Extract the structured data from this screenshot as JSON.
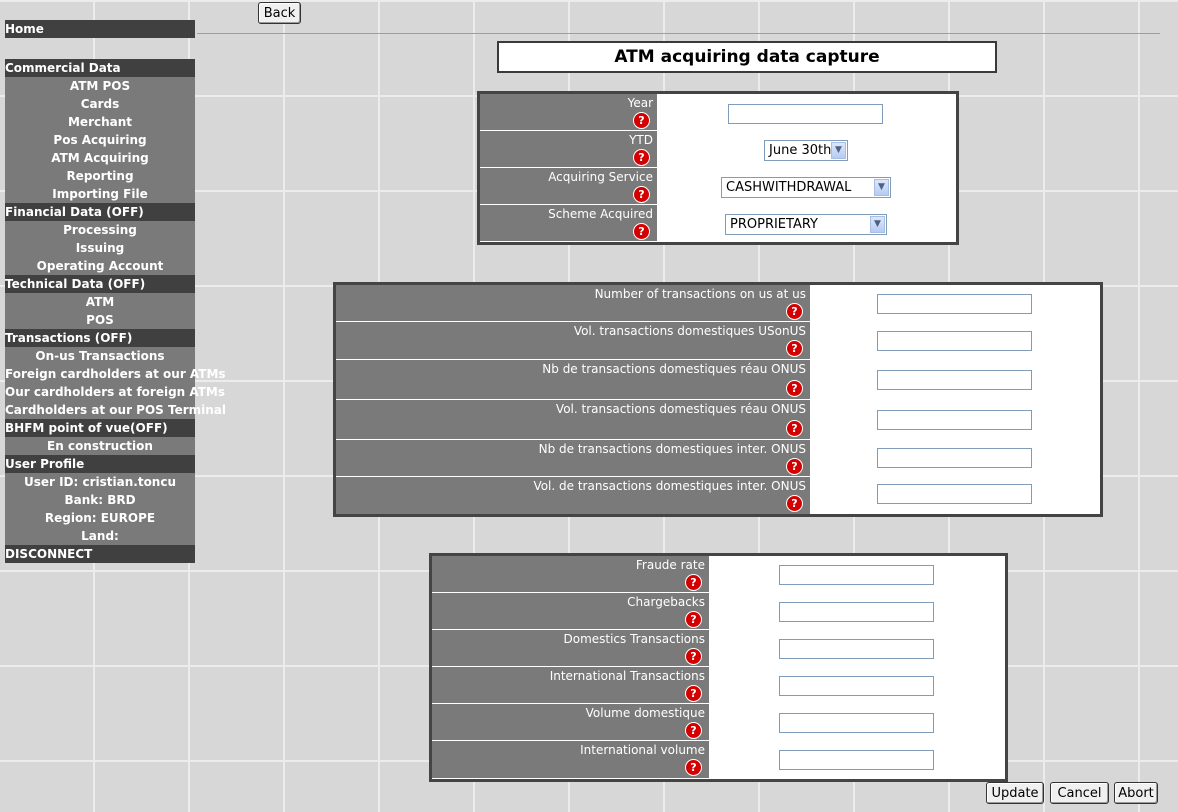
{
  "sidebar": {
    "home": "Home",
    "commercial": {
      "head": "Commercial Data",
      "items": [
        "ATM POS",
        "Cards",
        "Merchant",
        "Pos Acquiring",
        "ATM Acquiring",
        "Reporting",
        "Importing File"
      ]
    },
    "financial": {
      "head": "Financial Data (OFF)",
      "items": [
        "Processing",
        "Issuing",
        "Operating Account"
      ]
    },
    "technical": {
      "head": "Technical Data (OFF)",
      "items": [
        "ATM",
        "POS"
      ]
    },
    "transactions": {
      "head": "Transactions (OFF)",
      "items": [
        "On-us Transactions",
        "Foreign cardholders at our ATMs",
        "Our cardholders at foreign ATMs",
        "Cardholders at our POS Terminal"
      ]
    },
    "bhfm": {
      "head": "BHFM point of vue(OFF)",
      "items": [
        "En construction"
      ]
    },
    "profile": {
      "head": "User Profile",
      "items": [
        "User ID: cristian.toncu",
        "Bank: BRD",
        "Region: EUROPE",
        "Land:"
      ]
    },
    "disconnect": "DISCONNECT"
  },
  "top": {
    "back": "Back",
    "title": "ATM acquiring data capture"
  },
  "help_glyph": "?",
  "panel1": {
    "rows": [
      {
        "label": "Year",
        "value": ""
      },
      {
        "label": "YTD",
        "selected": "June 30th"
      },
      {
        "label": "Acquiring Service",
        "selected": "CASHWITHDRAWAL"
      },
      {
        "label": "Scheme Acquired",
        "selected": "PROPRIETARY"
      }
    ]
  },
  "panel2": {
    "rows": [
      {
        "label": "Number of transactions on us at us",
        "value": ""
      },
      {
        "label": "Vol. transactions domestiques USonUS",
        "value": ""
      },
      {
        "label": "Nb de transactions domestiques réau ONUS",
        "value": ""
      },
      {
        "label": "Vol. transactions domestiques réau ONUS",
        "value": ""
      },
      {
        "label": "Nb de transactions domestiques inter. ONUS",
        "value": ""
      },
      {
        "label": "Vol. de transactions domestiques inter. ONUS",
        "value": ""
      }
    ]
  },
  "panel3": {
    "rows": [
      {
        "label": "Fraude rate",
        "value": ""
      },
      {
        "label": "Chargebacks",
        "value": ""
      },
      {
        "label": "Domestics Transactions",
        "value": ""
      },
      {
        "label": "International Transactions",
        "value": ""
      },
      {
        "label": "Volume domestique",
        "value": ""
      },
      {
        "label": "International volume",
        "value": ""
      }
    ]
  },
  "actions": {
    "update": "Update",
    "cancel": "Cancel",
    "abort": "Abort"
  },
  "icons": {
    "select_arrow": "chevron-down-icon",
    "help": "help-icon"
  }
}
